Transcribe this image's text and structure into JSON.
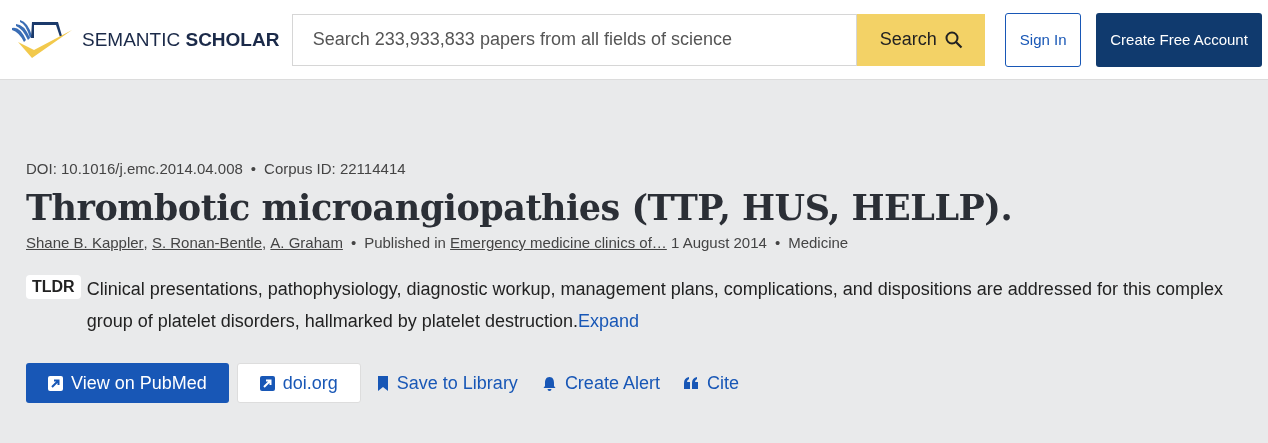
{
  "header": {
    "logo_text_light": "SEMANTIC",
    "logo_text_bold": "SCHOLAR",
    "search": {
      "placeholder": "Search 233,933,833 papers from all fields of science",
      "button": "Search"
    },
    "sign_in": "Sign In",
    "create_account": "Create Free Account"
  },
  "paper": {
    "doi": "DOI: 10.1016/j.emc.2014.04.008",
    "corpus_id": "Corpus ID: 22114414",
    "title": "Thrombotic microangiopathies (TTP, HUS, HELLP).",
    "bullet": "•",
    "author_separator": ",",
    "authors": [
      "Shane B. Kappler",
      "S. Ronan-Bentle",
      "A. Graham"
    ],
    "published_in_label": "Published in",
    "venue": "Emergency medicine clinics of…",
    "date": "1 August 2014",
    "field": "Medicine",
    "tldr": {
      "badge": "TLDR",
      "text": "Clinical presentations, pathophysiology, diagnostic workup, management plans, complications, and dispositions are addressed for this complex group of platelet disorders, hallmarked by platelet destruction.",
      "expand": "Expand"
    },
    "actions": [
      {
        "kind": "primary",
        "label": "View on PubMed"
      },
      {
        "kind": "outline",
        "label": "doi.org"
      },
      {
        "kind": "save",
        "label": "Save to Library"
      },
      {
        "kind": "alert",
        "label": "Create Alert"
      },
      {
        "kind": "cite",
        "label": "Cite"
      }
    ]
  }
}
